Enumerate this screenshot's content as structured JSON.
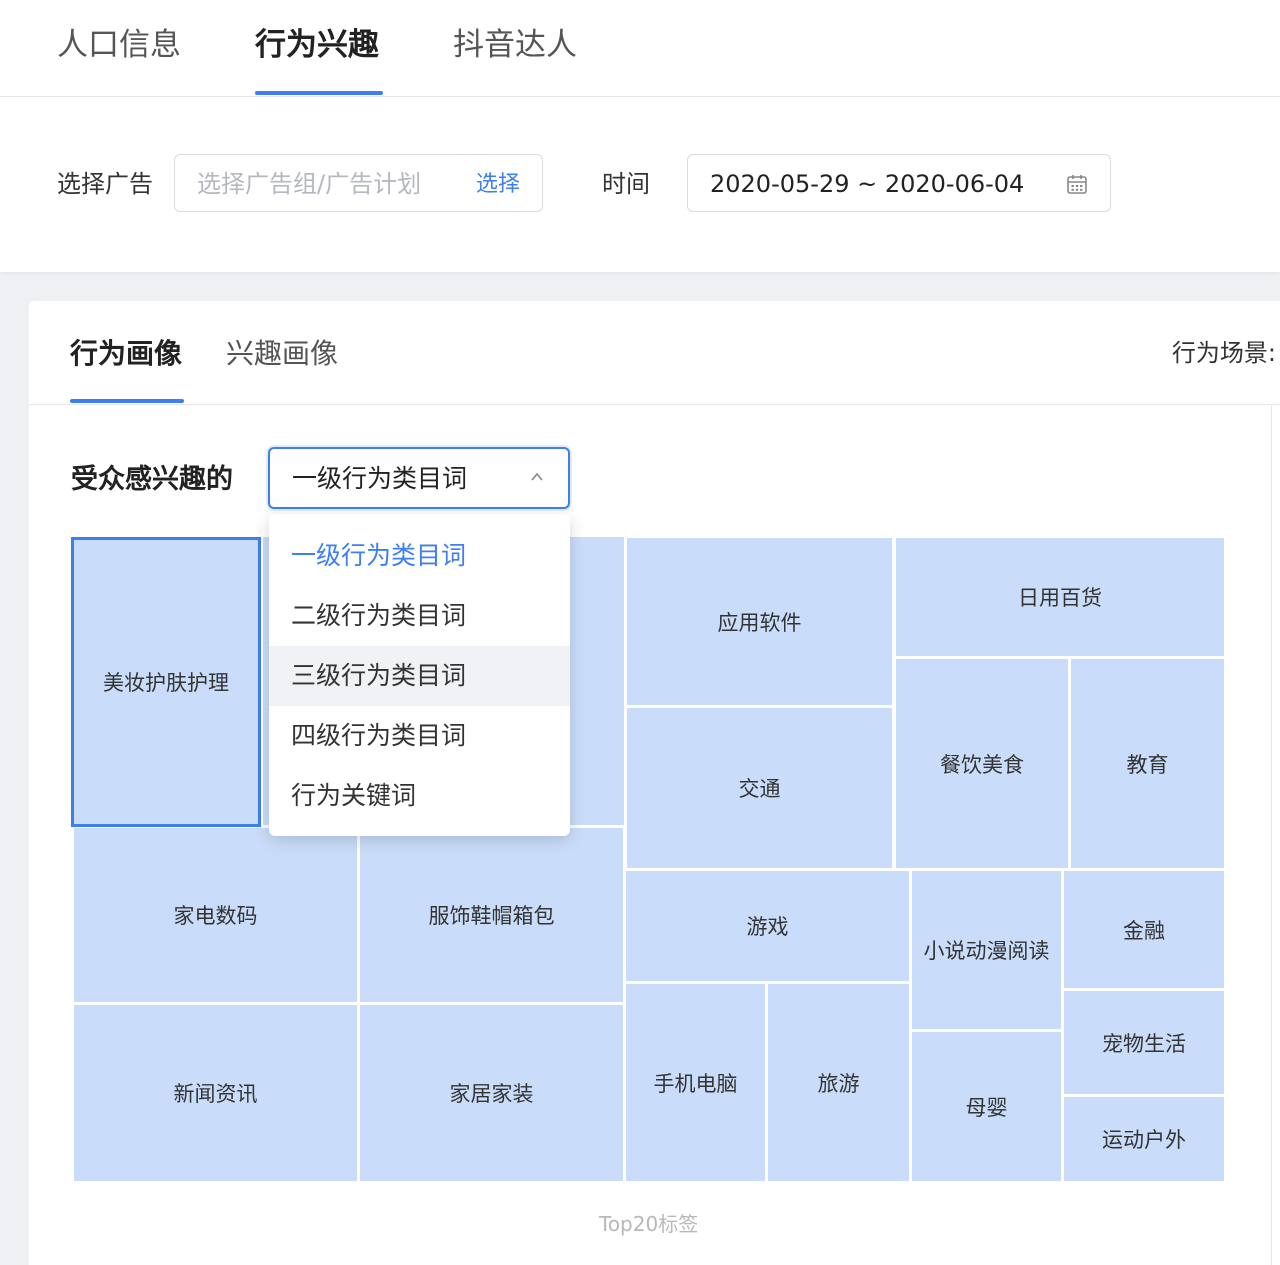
{
  "top_tabs": [
    {
      "label": "人口信息"
    },
    {
      "label": "行为兴趣"
    },
    {
      "label": "抖音达人"
    }
  ],
  "filter": {
    "ad_label": "选择广告",
    "ad_placeholder": "选择广告组/广告计划",
    "ad_select_link": "选择",
    "time_label": "时间",
    "date_range": "2020-05-29 ~ 2020-06-04"
  },
  "card": {
    "tabs": [
      {
        "label": "行为画像"
      },
      {
        "label": "兴趣画像"
      }
    ],
    "scene_label": "行为场景:",
    "interest_label": "受众感兴趣的",
    "select_value": "一级行为类目词",
    "dropdown_options": [
      {
        "label": "一级行为类目词",
        "state": "selected"
      },
      {
        "label": "二级行为类目词",
        "state": ""
      },
      {
        "label": "三级行为类目词",
        "state": "hover"
      },
      {
        "label": "四级行为类目词",
        "state": ""
      },
      {
        "label": "行为关键词",
        "state": ""
      }
    ],
    "treemap_cells": [
      {
        "label": "美妆护肤护理",
        "highlighted": true
      },
      {
        "label": "",
        "highlighted": false
      },
      {
        "label": "应用软件",
        "highlighted": false
      },
      {
        "label": "日用百货",
        "highlighted": false
      },
      {
        "label": "交通",
        "highlighted": false
      },
      {
        "label": "餐饮美食",
        "highlighted": false
      },
      {
        "label": "教育",
        "highlighted": false
      },
      {
        "label": "家电数码",
        "highlighted": false
      },
      {
        "label": "服饰鞋帽箱包",
        "highlighted": false
      },
      {
        "label": "游戏",
        "highlighted": false
      },
      {
        "label": "小说动漫阅读",
        "highlighted": false
      },
      {
        "label": "金融",
        "highlighted": false
      },
      {
        "label": "宠物生活",
        "highlighted": false
      },
      {
        "label": "新闻资讯",
        "highlighted": false
      },
      {
        "label": "家居家装",
        "highlighted": false
      },
      {
        "label": "手机电脑",
        "highlighted": false
      },
      {
        "label": "旅游",
        "highlighted": false
      },
      {
        "label": "母婴",
        "highlighted": false
      },
      {
        "label": "运动户外",
        "highlighted": false
      }
    ],
    "treemap_caption": "Top20标签"
  },
  "colors": {
    "accent": "#3d7ff0",
    "cell_fill": "#c9ddfa"
  }
}
